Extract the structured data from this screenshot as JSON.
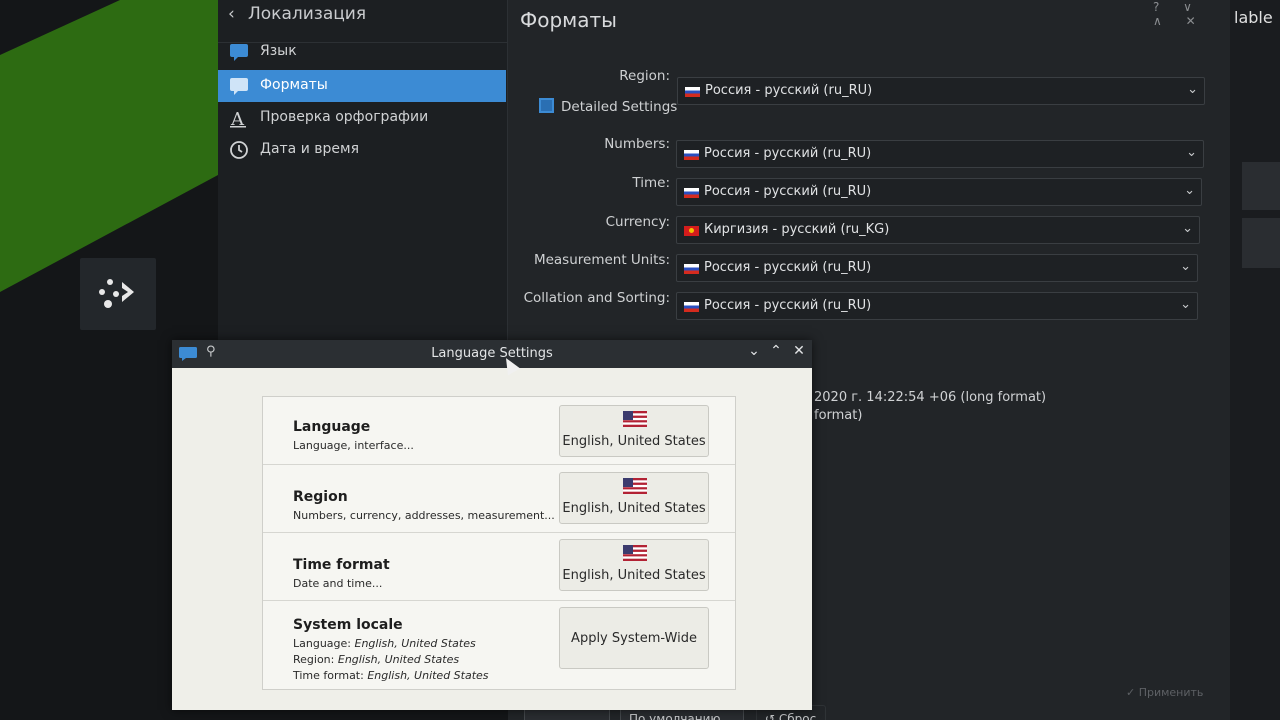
{
  "kde": {
    "back_title": "Локализация",
    "sidebar": [
      {
        "label": "Язык",
        "icon": "chat-bubble-icon"
      },
      {
        "label": "Форматы",
        "icon": "chat-bubble-icon"
      },
      {
        "label": "Проверка орфографии",
        "icon": "spellcheck-icon"
      },
      {
        "label": "Дата и время",
        "icon": "clock-icon"
      }
    ],
    "page_title": "Форматы",
    "window_controls": "? ∨ ∧ ✕",
    "right_label": "lable",
    "region_label": "Region:",
    "region_value": "Россия - русский (ru_RU)",
    "detailed_label": "Detailed Settings",
    "rows": [
      {
        "label": "Numbers:",
        "value": "Россия - русский (ru_RU)",
        "flag": "ru"
      },
      {
        "label": "Time:",
        "value": "Россия - русский (ru_RU)",
        "flag": "ru"
      },
      {
        "label": "Currency:",
        "value": "Киргизия - русский (ru_KG)",
        "flag": "kg"
      },
      {
        "label": "Measurement Units:",
        "value": "Россия - русский (ru_RU)",
        "flag": "ru"
      },
      {
        "label": "Collation and Sorting:",
        "value": "Россия - русский (ru_RU)",
        "flag": "ru"
      }
    ],
    "example_long": "2020 г. 14:22:54 +06 (long format)",
    "example_short": "format)",
    "bottom_buttons": [
      "",
      "По умолчанию",
      "↺ Сброс"
    ],
    "apply_label": "✓ Применить"
  },
  "dialog": {
    "title": "Language Settings",
    "rows": [
      {
        "title": "Language",
        "sub": "Language, interface...",
        "button": "English, United States"
      },
      {
        "title": "Region",
        "sub": "Numbers, currency, addresses, measurement...",
        "button": "English, United States"
      },
      {
        "title": "Time format",
        "sub": "Date and time...",
        "button": "English, United States"
      }
    ],
    "system_locale": {
      "title": "System locale",
      "language_label": "Language:",
      "language_value": "English, United States",
      "region_label": "Region:",
      "region_value": "English, United States",
      "time_label": "Time format:",
      "time_value": "English, United States",
      "button": "Apply System-Wide"
    }
  },
  "colors": {
    "accent": "#3c8bd4",
    "wallpaper": "#2d6b12"
  }
}
